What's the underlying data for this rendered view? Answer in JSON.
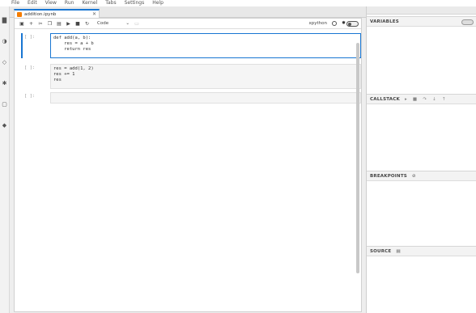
{
  "menubar": {
    "items": [
      "File",
      "Edit",
      "View",
      "Run",
      "Kernel",
      "Tabs",
      "Settings",
      "Help"
    ]
  },
  "leftbar": {
    "icons": [
      "folder-icon",
      "running-icon",
      "git-icon",
      "extension-icon",
      "tabs-icon",
      "puzzle-icon"
    ]
  },
  "notebook": {
    "tab_title": "addition.ipynb",
    "cell_type": "Code",
    "kernel_name": "xpython",
    "cells": [
      {
        "prompt": "[ ]:",
        "code": "def add(a, b):\n    res = a + b\n    return res"
      },
      {
        "prompt": "[ ]:",
        "code": "res = add(1, 2)\nres += 1\nres"
      },
      {
        "prompt": "[ ]:",
        "code": ""
      }
    ]
  },
  "debugger": {
    "variables_title": "VARIABLES",
    "callstack_title": "CALLSTACK",
    "breakpoints_title": "BREAKPOINTS",
    "source_title": "SOURCE"
  },
  "colors": {
    "accent": "#1976d2",
    "notebook_icon": "#f57c00"
  }
}
